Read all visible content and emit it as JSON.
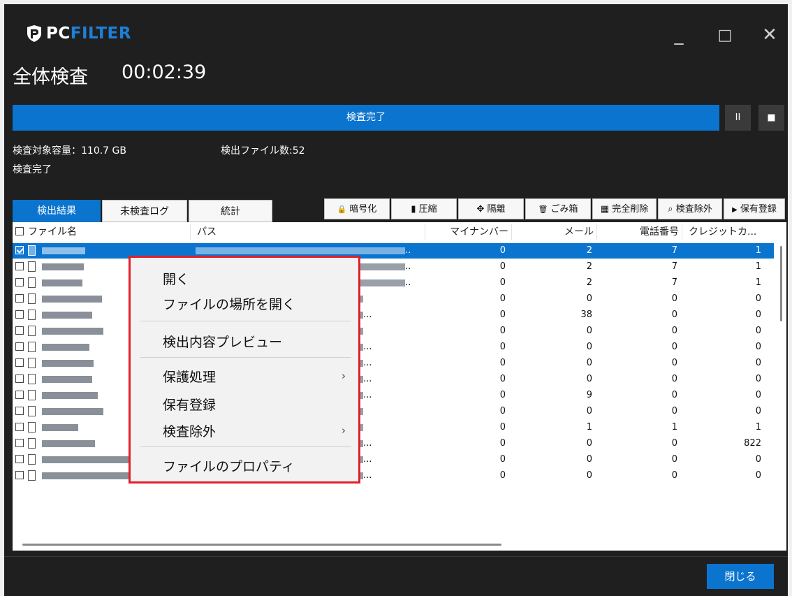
{
  "app": {
    "logo_pc": "PC",
    "logo_filter": "FILTER",
    "minimize": "_",
    "maximize": "□",
    "close": "✕"
  },
  "scan": {
    "title": "全体検査",
    "elapsed": "00:02:39",
    "progress_label": "検査完了",
    "progress": 1.0,
    "pause_glyph": "II",
    "stop_glyph": "■",
    "target_capacity": "検査対象容量：110.7 GB",
    "detected_files": "検出ファイル数:52",
    "status": "検査完了"
  },
  "tabs": [
    {
      "label": "検出結果",
      "active": true
    },
    {
      "label": "未検査ログ",
      "active": false
    },
    {
      "label": "統計",
      "active": false
    }
  ],
  "toolbar": {
    "encrypt": "暗号化",
    "compress": "圧縮",
    "isolate": "隔離",
    "trash": "ごみ箱",
    "full_delete": "完全削除",
    "exclude": "検査除外",
    "register": "保有登録",
    "icon_lock": "🔒",
    "icon_zip": "▮",
    "icon_move": "✥",
    "icon_trash": "🗑",
    "icon_shred": "▦",
    "icon_search": "⌕",
    "icon_reg": "▶"
  },
  "table": {
    "headers": {
      "filename": "ファイル名",
      "path": "パス",
      "mynumber": "マイナンバー",
      "mail": "メール",
      "phone": "電話番号",
      "credit": "クレジットカ..."
    },
    "rows": [
      {
        "checked": true,
        "path_tail": "..",
        "mynumber": "0",
        "mail": "2",
        "phone": "7",
        "credit": "1"
      },
      {
        "checked": false,
        "path_tail": "..",
        "mynumber": "0",
        "mail": "2",
        "phone": "7",
        "credit": "1"
      },
      {
        "checked": false,
        "path_tail": "..",
        "mynumber": "0",
        "mail": "2",
        "phone": "7",
        "credit": "1"
      },
      {
        "checked": false,
        "path_tail": "",
        "mynumber": "0",
        "mail": "0",
        "phone": "0",
        "credit": "0"
      },
      {
        "checked": false,
        "path_tail": "...",
        "mynumber": "0",
        "mail": "38",
        "phone": "0",
        "credit": "0"
      },
      {
        "checked": false,
        "path_tail": "",
        "mynumber": "0",
        "mail": "0",
        "phone": "0",
        "credit": "0"
      },
      {
        "checked": false,
        "path_tail": "...",
        "mynumber": "0",
        "mail": "0",
        "phone": "0",
        "credit": "0"
      },
      {
        "checked": false,
        "path_tail": "...",
        "mynumber": "0",
        "mail": "0",
        "phone": "0",
        "credit": "0"
      },
      {
        "checked": false,
        "path_tail": "...",
        "mynumber": "0",
        "mail": "0",
        "phone": "0",
        "credit": "0"
      },
      {
        "checked": false,
        "path_tail": "...",
        "mynumber": "0",
        "mail": "9",
        "phone": "0",
        "credit": "0"
      },
      {
        "checked": false,
        "path_tail": "",
        "mynumber": "0",
        "mail": "0",
        "phone": "0",
        "credit": "0"
      },
      {
        "checked": false,
        "path_tail": "",
        "mynumber": "0",
        "mail": "1",
        "phone": "1",
        "credit": "1"
      },
      {
        "checked": false,
        "path_tail": "...",
        "mynumber": "0",
        "mail": "0",
        "phone": "0",
        "credit": "822"
      },
      {
        "checked": false,
        "path_tail": "...",
        "mynumber": "0",
        "mail": "0",
        "phone": "0",
        "credit": "0"
      },
      {
        "checked": false,
        "path_tail": "...",
        "mynumber": "0",
        "mail": "0",
        "phone": "0",
        "credit": "0"
      }
    ]
  },
  "context_menu": {
    "open": "開く",
    "open_location": "ファイルの場所を開く",
    "preview": "検出内容プレビュー",
    "protect": "保護処理",
    "register": "保有登録",
    "exclude": "検査除外",
    "properties": "ファイルのプロパティ",
    "submenu_arrow": "›"
  },
  "footer": {
    "close": "閉じる"
  },
  "colors": {
    "accent": "#0a74cf",
    "background": "#1f1f1f",
    "menu_highlight_border": "#e0202a"
  }
}
